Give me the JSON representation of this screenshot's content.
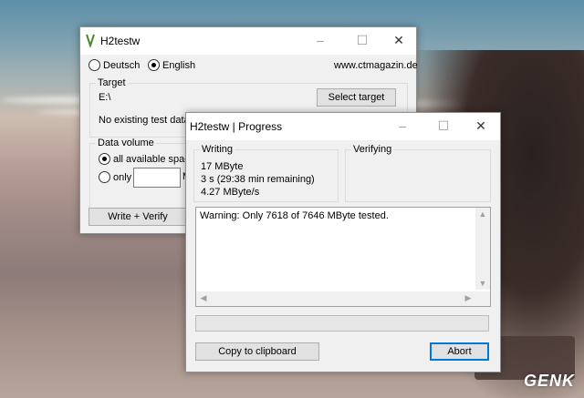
{
  "main_window": {
    "title": "H2testw",
    "lang_deutsch": "Deutsch",
    "lang_english": "English",
    "website": "www.ctmagazin.de",
    "target_label": "Target",
    "target_path": "E:\\",
    "select_target": "Select target",
    "no_test_data": "No existing test data.",
    "data_volume_label": "Data volume",
    "all_space": "all available space (",
    "only_label": "only",
    "only_value": "",
    "unit_partial": "M",
    "write_verify": "Write + Verify"
  },
  "progress_window": {
    "title": "H2testw | Progress",
    "writing_label": "Writing",
    "written": "17 MByte",
    "time": "3 s (29:38 min remaining)",
    "speed": "4.27 MByte/s",
    "verifying_label": "Verifying",
    "warning": "Warning: Only 7618 of 7646 MByte tested.",
    "copy_button": "Copy to clipboard",
    "abort_button": "Abort",
    "progress_fraction": 0.0
  },
  "watermark": "GENK",
  "icons": [
    "minimize-icon",
    "maximize-icon",
    "close-icon",
    "app-icon"
  ]
}
